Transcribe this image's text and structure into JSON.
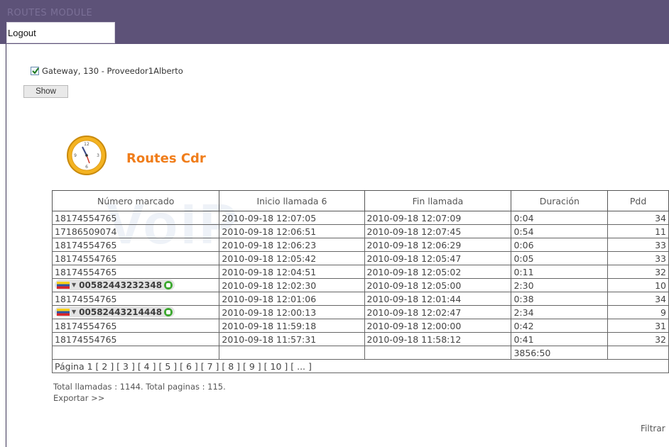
{
  "header": {
    "module_title": "ROUTES MODULE",
    "logout_label": "Logout"
  },
  "filter": {
    "gateway_label": "Gateway, 130 - Proveedor1Alberto",
    "gateway_checked": true,
    "show_label": "Show"
  },
  "section": {
    "title": "Routes Cdr",
    "icon": "clock-icon"
  },
  "watermark": "VoIP",
  "table": {
    "columns": [
      "Número marcado",
      "Inicio llamada 6",
      "Fin llamada",
      "Duración",
      "Pdd"
    ],
    "rows": [
      {
        "number": "18174554765",
        "start": "2010-09-18 12:07:05",
        "end": "2010-09-18 12:07:09",
        "duration": "0:04",
        "pdd": "34",
        "phone": false
      },
      {
        "number": "17186509074",
        "start": "2010-09-18 12:06:51",
        "end": "2010-09-18 12:07:45",
        "duration": "0:54",
        "pdd": "11",
        "phone": false
      },
      {
        "number": "18174554765",
        "start": "2010-09-18 12:06:23",
        "end": "2010-09-18 12:06:29",
        "duration": "0:06",
        "pdd": "33",
        "phone": false
      },
      {
        "number": "18174554765",
        "start": "2010-09-18 12:05:42",
        "end": "2010-09-18 12:05:47",
        "duration": "0:05",
        "pdd": "33",
        "phone": false
      },
      {
        "number": "18174554765",
        "start": "2010-09-18 12:04:51",
        "end": "2010-09-18 12:05:02",
        "duration": "0:11",
        "pdd": "32",
        "phone": false
      },
      {
        "number": "00582443232348",
        "start": "2010-09-18 12:02:30",
        "end": "2010-09-18 12:05:00",
        "duration": "2:30",
        "pdd": "10",
        "phone": true
      },
      {
        "number": "18174554765",
        "start": "2010-09-18 12:01:06",
        "end": "2010-09-18 12:01:44",
        "duration": "0:38",
        "pdd": "34",
        "phone": false
      },
      {
        "number": "00582443214448",
        "start": "2010-09-18 12:00:13",
        "end": "2010-09-18 12:02:47",
        "duration": "2:34",
        "pdd": "9",
        "phone": true
      },
      {
        "number": "18174554765",
        "start": "2010-09-18 11:59:18",
        "end": "2010-09-18 12:00:00",
        "duration": "0:42",
        "pdd": "31",
        "phone": false
      },
      {
        "number": "18174554765",
        "start": "2010-09-18 11:57:31",
        "end": "2010-09-18 11:58:12",
        "duration": "0:41",
        "pdd": "32",
        "phone": false
      }
    ],
    "total_duration": "3856:50",
    "pager": {
      "prefix": "Página 1",
      "pages": [
        "2",
        "3",
        "4",
        "5",
        "6",
        "7",
        "8",
        "9",
        "10",
        "..."
      ]
    }
  },
  "summary": "Total llamadas : 1144. Total paginas : 115.",
  "export_label": "Exportar >>",
  "filter_link": "Filtrar"
}
